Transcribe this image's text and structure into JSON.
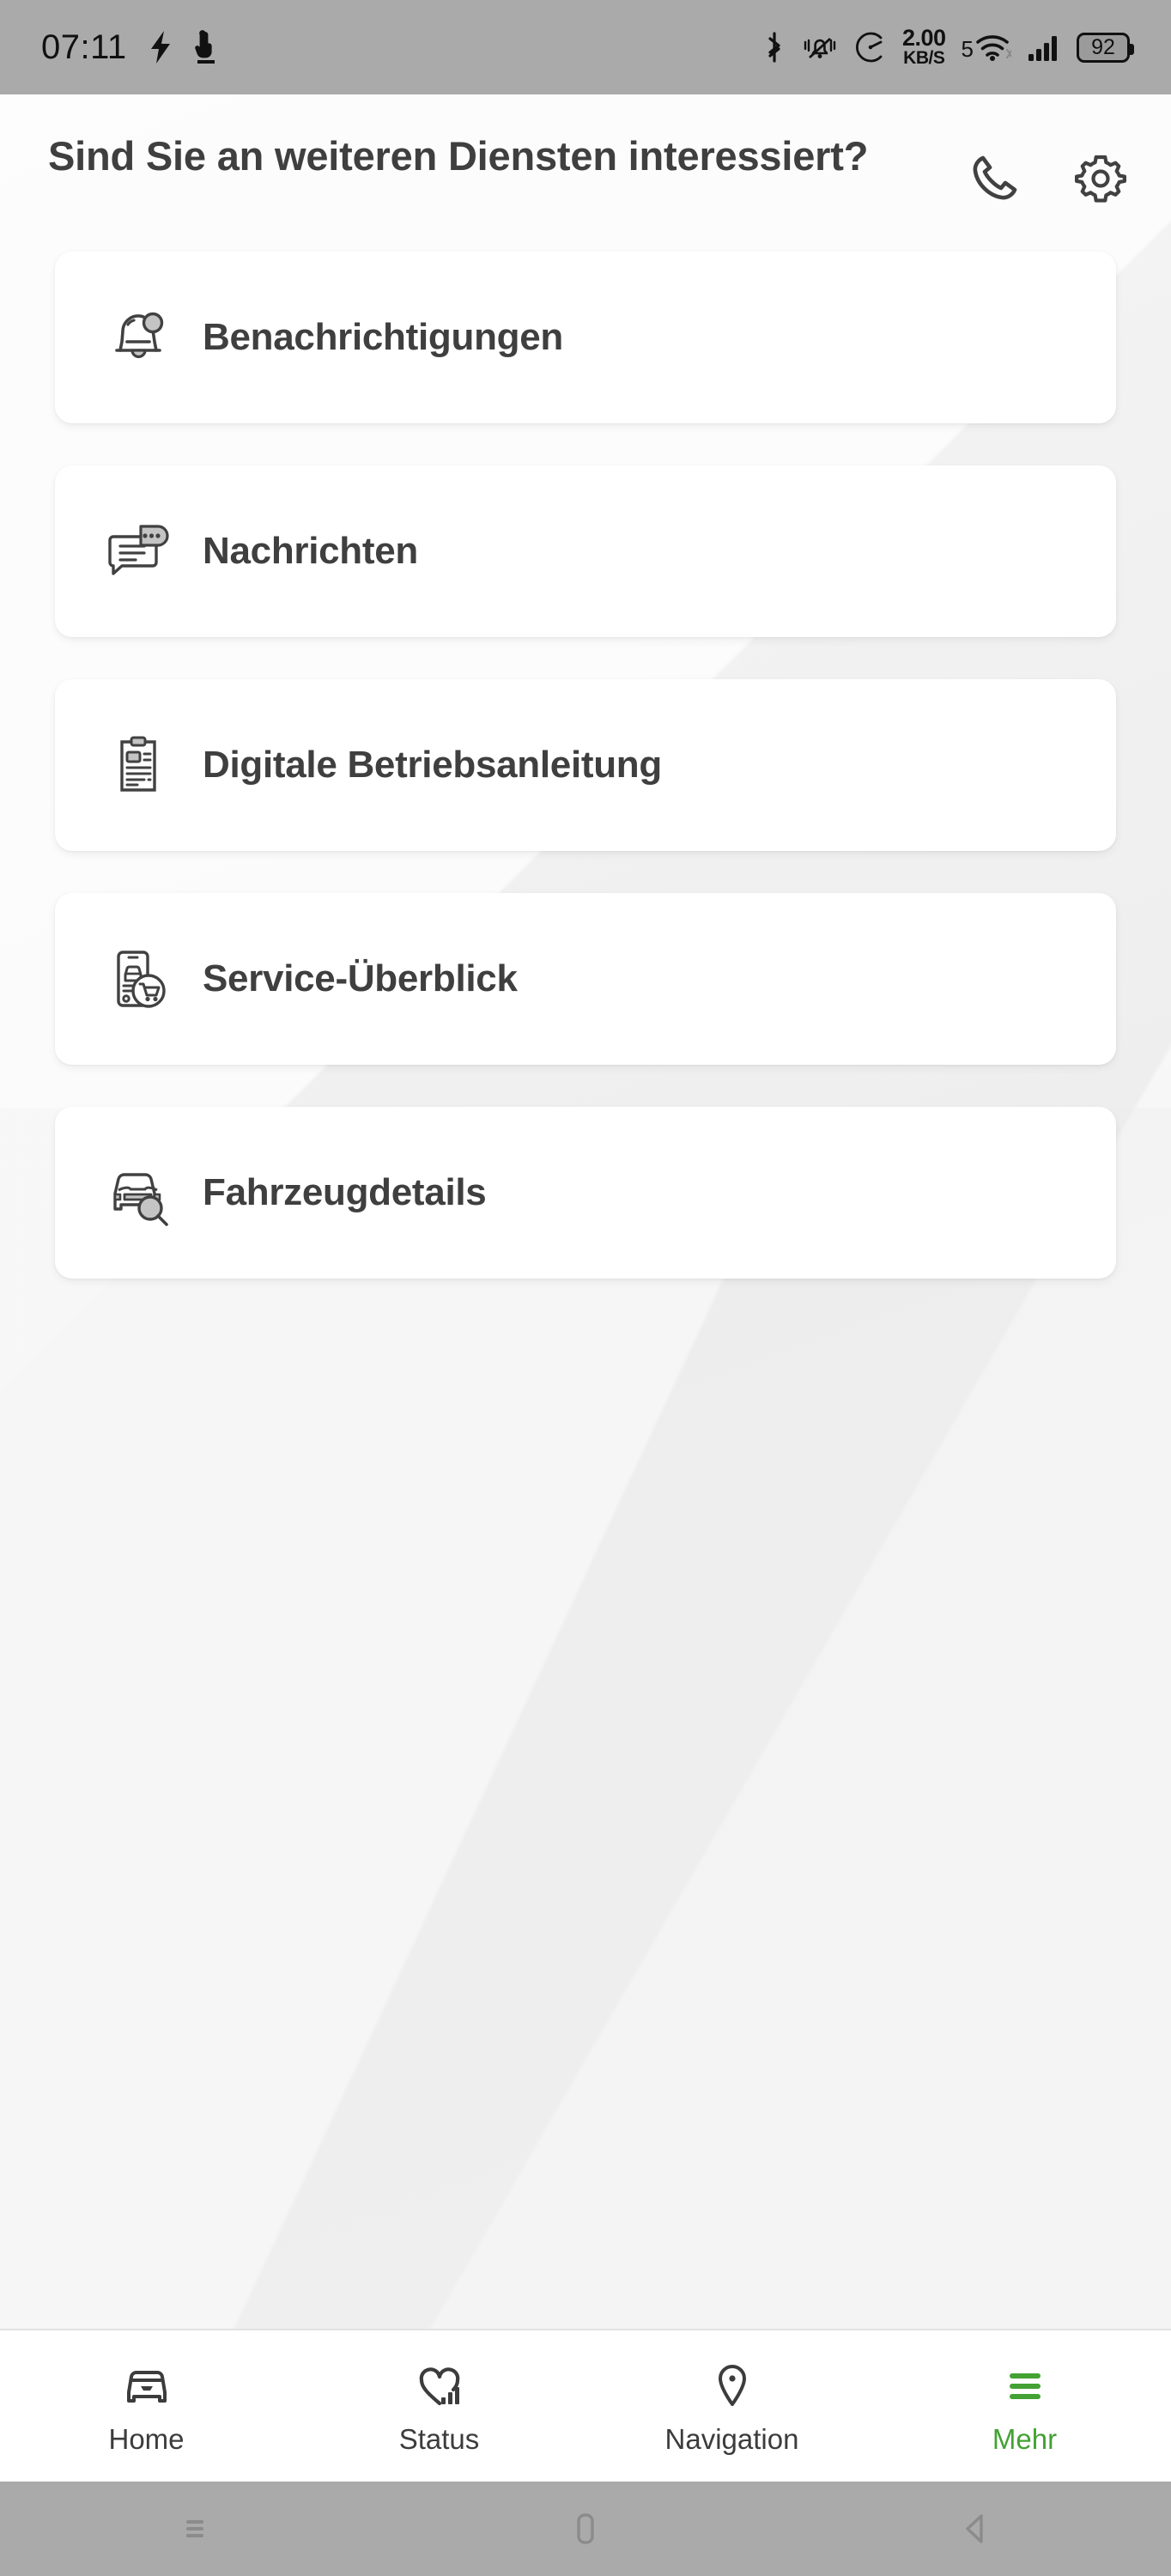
{
  "status_bar": {
    "time": "07:11",
    "left_icons": [
      "flash-icon",
      "touch-pointer-icon"
    ],
    "bluetooth_icon": "bluetooth-icon",
    "ringer_icon": "vibrate-off-icon",
    "speedometer_icon": "speedometer-icon",
    "net_speed_value": "2.00",
    "net_speed_unit": "KB/S",
    "wifi_generation": "5",
    "wifi_icon": "wifi-icon",
    "signal_icon": "cellular-signal-icon",
    "battery_level": "92"
  },
  "header": {
    "title": "Sind Sie an weiteren Diensten interessiert?",
    "call_button": "phone-icon",
    "settings_button": "gear-icon"
  },
  "cards": [
    {
      "id": "benachrichtigungen",
      "label": "Benachrichtigungen",
      "icon": "bell-notification-icon"
    },
    {
      "id": "nachrichten",
      "label": "Nachrichten",
      "icon": "chat-messages-icon"
    },
    {
      "id": "betriebsanleitung",
      "label": "Digitale Betriebsanleitung",
      "icon": "clipboard-manual-icon"
    },
    {
      "id": "service-ueberblick",
      "label": "Service-Überblick",
      "icon": "phone-car-cart-icon"
    },
    {
      "id": "fahrzeugdetails",
      "label": "Fahrzeugdetails",
      "icon": "car-magnifier-icon"
    }
  ],
  "bottom_nav": {
    "active_id": "mehr",
    "active_color": "#43a233",
    "items": [
      {
        "id": "home",
        "label": "Home",
        "icon": "car-front-icon"
      },
      {
        "id": "status",
        "label": "Status",
        "icon": "heart-bars-icon"
      },
      {
        "id": "navigation",
        "label": "Navigation",
        "icon": "map-pin-icon"
      },
      {
        "id": "mehr",
        "label": "Mehr",
        "icon": "hamburger-menu-icon"
      }
    ]
  },
  "android_nav": {
    "recents": "recents-icon",
    "home": "home-square-icon",
    "back": "back-triangle-icon"
  }
}
